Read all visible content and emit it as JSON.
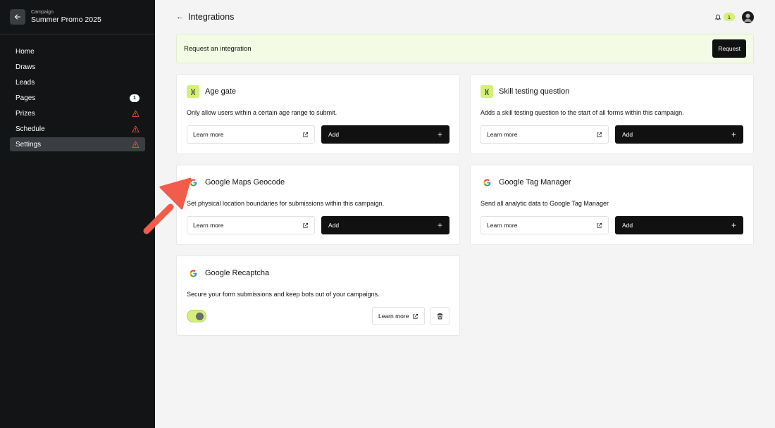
{
  "sidebar": {
    "campaign_label": "Campaign",
    "campaign_name": "Summer Promo 2025",
    "items": [
      {
        "label": "Home"
      },
      {
        "label": "Draws"
      },
      {
        "label": "Leads"
      },
      {
        "label": "Pages",
        "badge": "1"
      },
      {
        "label": "Prizes",
        "warning": true
      },
      {
        "label": "Schedule",
        "warning": true
      },
      {
        "label": "Settings",
        "warning": true,
        "active": true
      }
    ]
  },
  "header": {
    "title": "Integrations",
    "notification_count": "1"
  },
  "request_bar": {
    "text": "Request an integration",
    "button_label": "Request"
  },
  "integrations": [
    {
      "title": "Age gate",
      "description": "Only allow users within a certain age range to submit.",
      "icon": "brand-logo-icon",
      "learn_label": "Learn more",
      "add_label": "Add"
    },
    {
      "title": "Skill testing question",
      "description": "Adds a skill testing question to the start of all forms within this campaign.",
      "icon": "brand-logo-icon",
      "learn_label": "Learn more",
      "add_label": "Add"
    },
    {
      "title": "Google Maps Geocode",
      "description": "Set physical location boundaries for submissions within this campaign.",
      "icon": "google-icon",
      "learn_label": "Learn more",
      "add_label": "Add"
    },
    {
      "title": "Google Tag Manager",
      "description": "Send all analytic data to Google Tag Manager",
      "icon": "google-icon",
      "learn_label": "Learn more",
      "add_label": "Add"
    },
    {
      "title": "Google Recaptcha",
      "description": "Secure your form submissions and keep bots out of your campaigns.",
      "icon": "google-icon",
      "learn_label": "Learn more",
      "enabled": true
    }
  ],
  "brand_logo_glyph": ")(",
  "colors": {
    "sidebar_bg": "#121416",
    "accent_lime": "#d4f07a",
    "primary_button": "#111111",
    "warning": "#e5533d",
    "annotation_arrow": "#f25c4a"
  }
}
